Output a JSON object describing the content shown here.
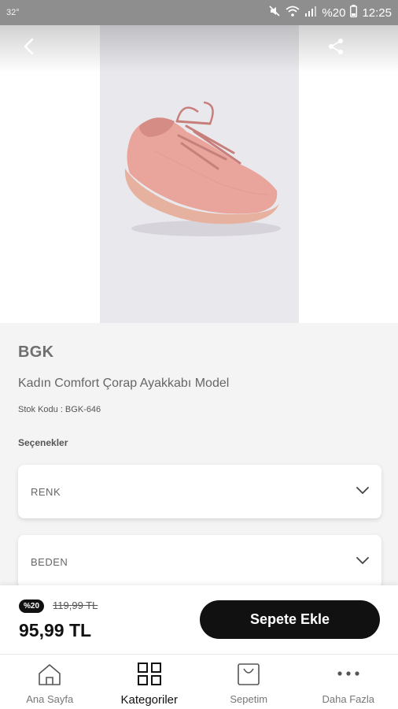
{
  "status_bar": {
    "temperature": "32°",
    "battery_text": "%20",
    "time": "12:25"
  },
  "product": {
    "brand": "BGK",
    "name": "Kadın Comfort Çorap Ayakkabı Model",
    "stock_code": "Stok Kodu : BGK-646",
    "options_title": "Seçenekler",
    "options": [
      {
        "label": "RENK"
      },
      {
        "label": "BEDEN"
      }
    ]
  },
  "pricing": {
    "discount_badge": "%20",
    "old_price": "119,99 TL",
    "new_price": "95,99 TL",
    "add_to_cart_label": "Sepete Ekle"
  },
  "tabs": [
    {
      "label": "Ana Sayfa",
      "icon": "home-icon",
      "active": false
    },
    {
      "label": "Kategoriler",
      "icon": "grid-icon",
      "active": true
    },
    {
      "label": "Sepetim",
      "icon": "bag-icon",
      "active": false
    },
    {
      "label": "Daha Fazla",
      "icon": "more-icon",
      "active": false
    }
  ],
  "colors": {
    "accent": "#111111",
    "shoe": "#e9a59c"
  }
}
